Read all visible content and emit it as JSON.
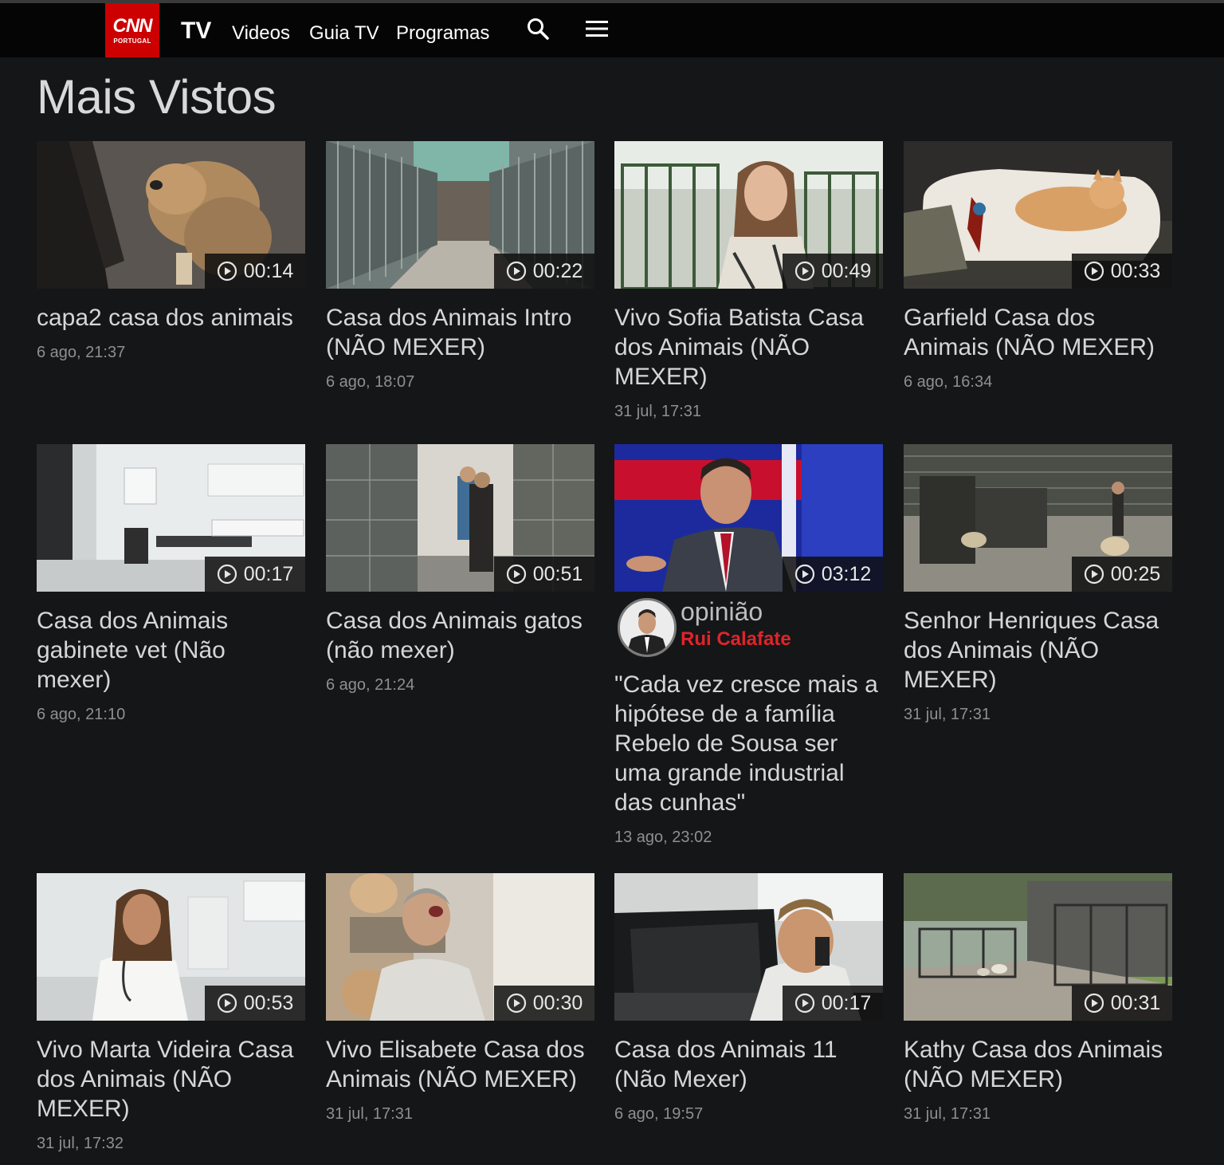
{
  "header": {
    "logo_text": "CNN",
    "logo_subtext": "PORTUGAL",
    "tv_label": "TV",
    "nav": [
      "Videos",
      "Guia TV",
      "Programas"
    ],
    "search_icon": "search-icon",
    "menu_icon": "hamburger-menu-icon",
    "brand_color": "#cc0000"
  },
  "page": {
    "title": "Mais Vistos"
  },
  "videos": [
    {
      "title": "capa2 casa dos animais",
      "date": "6 ago, 21:37",
      "duration": "00:14"
    },
    {
      "title": "Casa dos Animais Intro (NÃO MEXER)",
      "date": "6 ago, 18:07",
      "duration": "00:22"
    },
    {
      "title": "Vivo Sofia Batista Casa dos Animais (NÃO MEXER)",
      "date": "31 jul, 17:31",
      "duration": "00:49"
    },
    {
      "title": "Garfield Casa dos Animais (NÃO MEXER)",
      "date": "6 ago, 16:34",
      "duration": "00:33"
    },
    {
      "title": "Casa dos Animais gabinete vet (Não mexer)",
      "date": "6 ago, 21:10",
      "duration": "00:17"
    },
    {
      "title": "Casa dos Animais gatos (não mexer)",
      "date": "6 ago, 21:24",
      "duration": "00:51"
    },
    {
      "label": "opinião",
      "author": "Rui Calafate",
      "title": "\"Cada vez cresce mais a hipótese de a família Rebelo de Sousa ser uma grande industrial das cunhas\"",
      "date": "13 ago, 23:02",
      "duration": "03:12"
    },
    {
      "title": "Senhor Henriques Casa dos Animais (NÃO MEXER)",
      "date": "31 jul, 17:31",
      "duration": "00:25"
    },
    {
      "title": "Vivo Marta Videira Casa dos Animais (NÃO MEXER)",
      "date": "31 jul, 17:32",
      "duration": "00:53"
    },
    {
      "title": "Vivo Elisabete Casa dos Animais (NÃO MEXER)",
      "date": "31 jul, 17:31",
      "duration": "00:30"
    },
    {
      "title": "Casa dos Animais 11 (Não Mexer)",
      "date": "6 ago, 19:57",
      "duration": "00:17"
    },
    {
      "title": "Kathy Casa dos Animais (NÃO MEXER)",
      "date": "31 jul, 17:31",
      "duration": "00:31"
    }
  ]
}
